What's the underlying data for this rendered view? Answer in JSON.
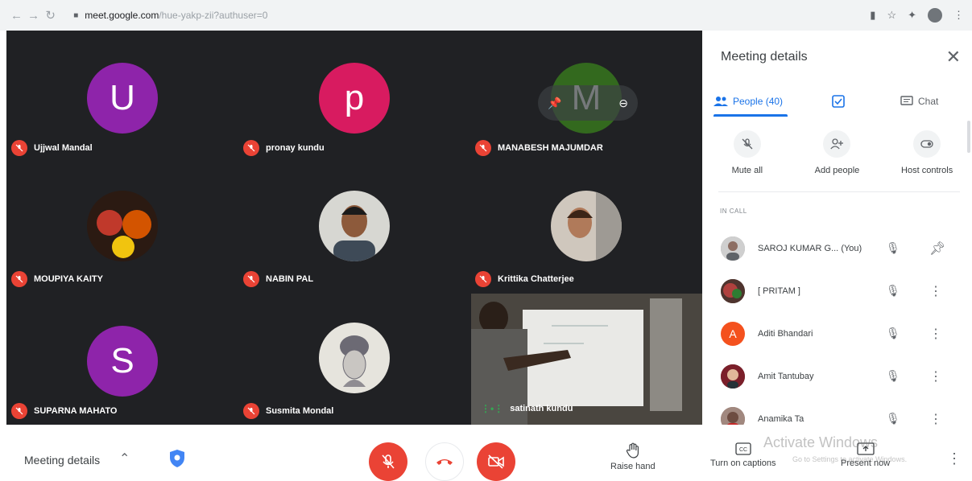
{
  "browser": {
    "url_host": "meet.google.com",
    "url_rest": "/hue-yakp-zii?authuser=0"
  },
  "tiles": [
    {
      "name": "Ujjwal Mandal",
      "initial": "U",
      "color": "#8e24aa"
    },
    {
      "name": "pronay kundu",
      "initial": "p",
      "color": "#d81b60"
    },
    {
      "name": "MANABESH MAJUMDAR",
      "initial": "M",
      "color": "#33691e"
    },
    {
      "name": "MOUPIYA KAITY"
    },
    {
      "name": "NABIN PAL"
    },
    {
      "name": "Krittika Chatterjee"
    },
    {
      "name": "SUPARNA MAHATO",
      "initial": "S",
      "color": "#8e24aa"
    },
    {
      "name": "Susmita Mondal"
    },
    {
      "name": "satinath kundu"
    }
  ],
  "panel": {
    "title": "Meeting details",
    "tabs": {
      "people": "People (40)",
      "chat": "Chat"
    },
    "actions": {
      "mute_all": "Mute all",
      "add_people": "Add people",
      "host_controls": "Host controls"
    },
    "in_call_label": "IN CALL",
    "participants": [
      {
        "name": "SAROJ KUMAR G...",
        "you": "(You)",
        "avatar_color": "#9e9e9e"
      },
      {
        "name": "[ PRITAM ]",
        "avatar_color": "#6d4c41"
      },
      {
        "name": "Aditi Bhandari",
        "initial": "A",
        "avatar_color": "#f4511e"
      },
      {
        "name": "Amit Tantubay",
        "avatar_color": "#5d4037"
      },
      {
        "name": "Anamika Ta",
        "avatar_color": "#8d6e63"
      }
    ]
  },
  "bottom": {
    "meeting_details": "Meeting details",
    "raise_hand": "Raise hand",
    "captions": "Turn on captions",
    "present": "Present now",
    "watermark_title": "Activate Windows",
    "watermark_sub": "Go to Settings to activate Windows."
  },
  "colors": {
    "accent": "#1a73e8",
    "danger": "#ea4335",
    "meeting_bg": "#202124"
  }
}
